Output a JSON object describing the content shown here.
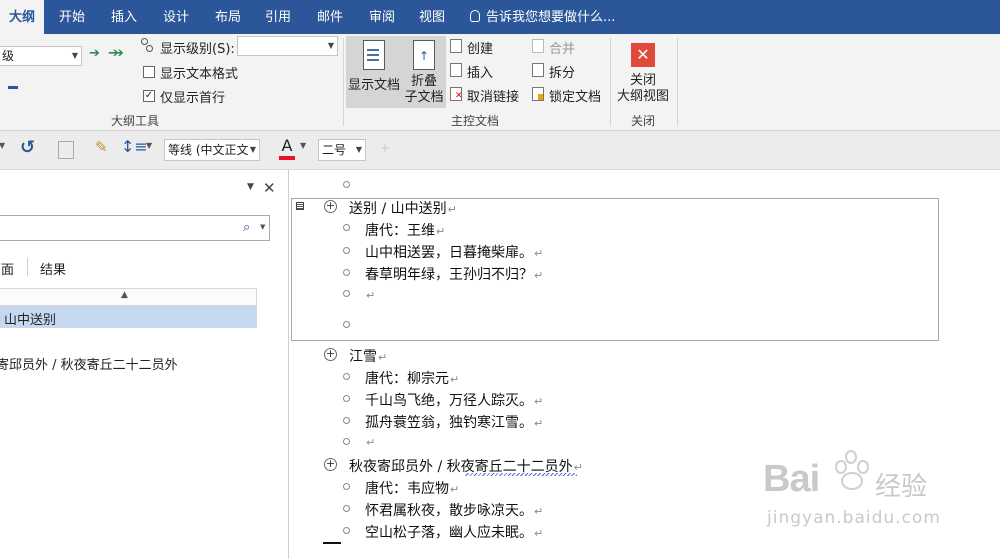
{
  "tabs": [
    {
      "label": "大纲",
      "active": true
    },
    {
      "label": "开始"
    },
    {
      "label": "插入"
    },
    {
      "label": "设计"
    },
    {
      "label": "布局"
    },
    {
      "label": "引用"
    },
    {
      "label": "邮件"
    },
    {
      "label": "审阅"
    },
    {
      "label": "视图"
    }
  ],
  "tell_me": "告诉我您想要做什么...",
  "outline_tools": {
    "level_value": "级",
    "show_level_label": "显示级别(S):",
    "show_text_format_label": "显示文本格式",
    "show_first_line_label": "仅显示首行",
    "show_text_format_checked": false,
    "show_first_line_checked": true,
    "group_label": "大纲工具"
  },
  "master_document": {
    "show_document": "显示文档",
    "collapse_line1": "折叠",
    "collapse_line2": "子文档",
    "create": "创建",
    "insert": "插入",
    "unlink": "取消链接",
    "merge": "合并",
    "split": "拆分",
    "lock": "锁定文档",
    "group_label": "主控文档"
  },
  "close_group": {
    "close_line1": "关闭",
    "close_line2": "大纲视图",
    "group_label": "关闭"
  },
  "format_bar": {
    "font": "等线 (中文正文",
    "size": "二号",
    "font_color": "#e81123"
  },
  "nav_pane": {
    "tab_pages": "页面",
    "tab_results": "结果",
    "heading_1": "山中送别",
    "heading_2": "寄邱员外 / 秋夜寄丘二十二员外"
  },
  "document": {
    "poems": [
      {
        "title": "送别 / 山中送别",
        "lines": [
          "唐代：王维",
          "山中相送罢，日暮掩柴扉。",
          "春草明年绿，王孙归不归？",
          ""
        ]
      },
      {
        "title": "江雪",
        "lines": [
          "唐代：柳宗元",
          "千山鸟飞绝，万径人踪灭。",
          "孤舟蓑笠翁，独钓寒江雪。",
          ""
        ]
      },
      {
        "title": "秋夜寄邱员外 / 秋夜寄丘二十二员外",
        "lines": [
          "唐代：韦应物",
          "怀君属秋夜，散步咏凉天。",
          "空山松子落，幽人应未眠。"
        ]
      }
    ],
    "para_mark": "↵"
  },
  "watermark": {
    "brand": "Bai",
    "brand_cn": "经验",
    "url": "jingyan.baidu.com"
  }
}
